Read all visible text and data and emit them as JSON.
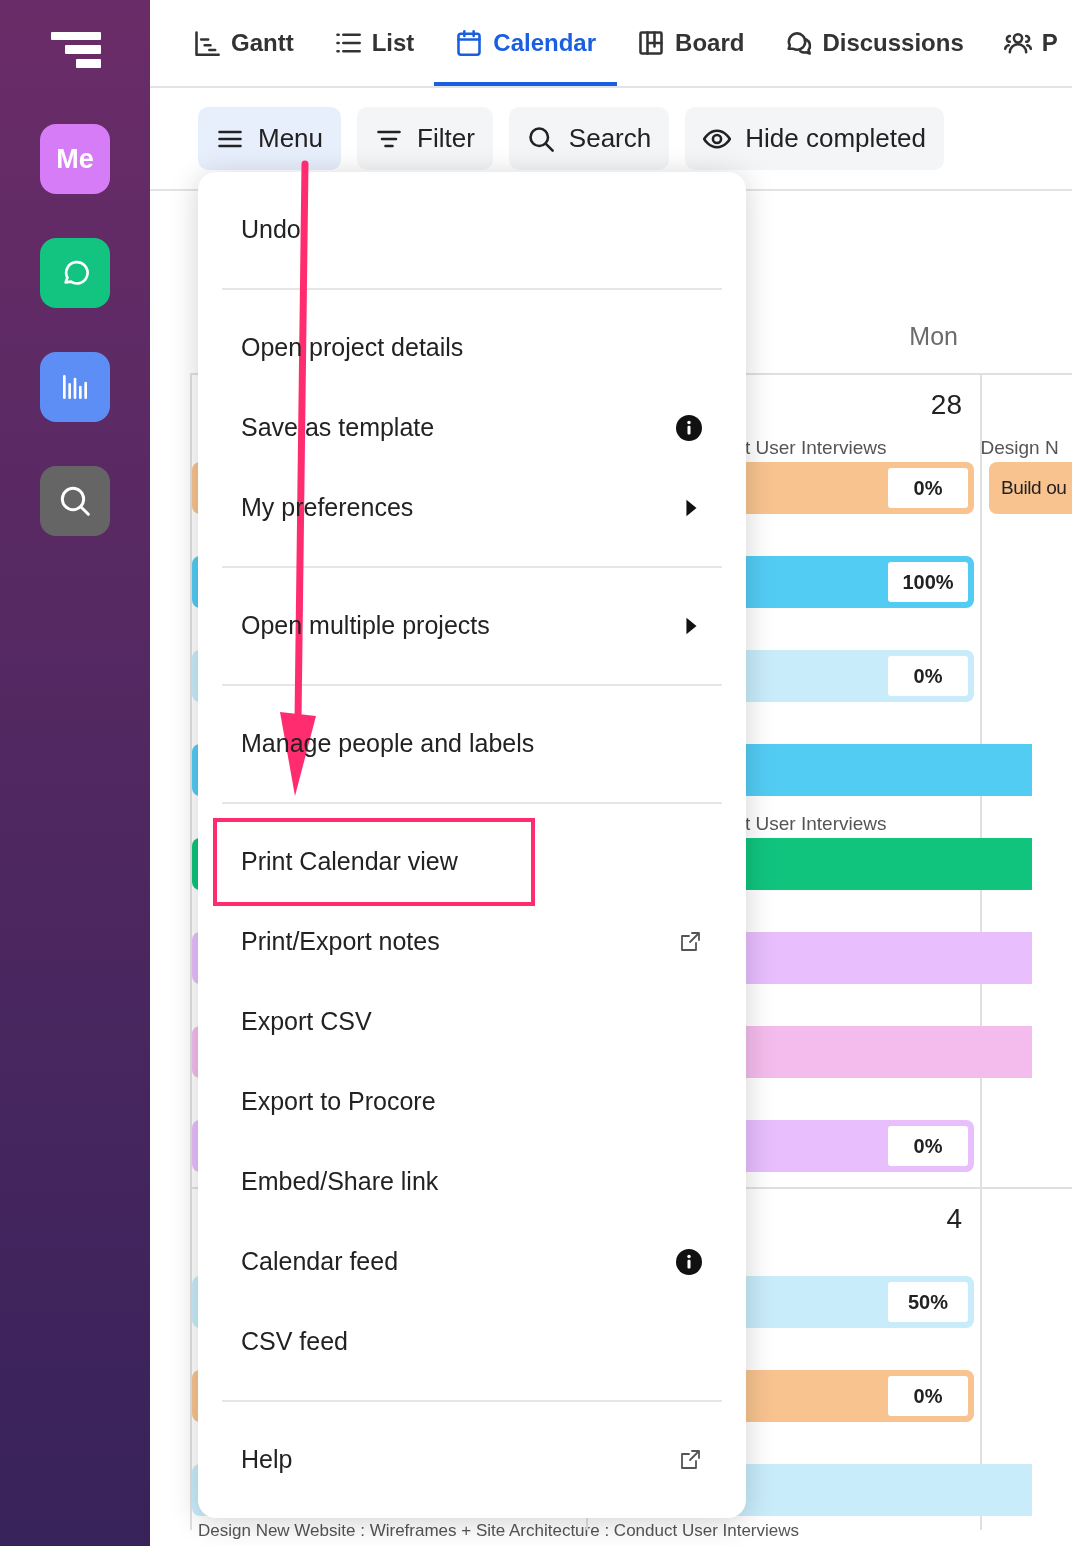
{
  "sidebar": {
    "items": [
      {
        "kind": "avatar",
        "label": "Me",
        "color": "#d57cf6"
      },
      {
        "kind": "chat",
        "color": "#12c480"
      },
      {
        "kind": "reports",
        "color": "#5d8ef6"
      },
      {
        "kind": "search",
        "color": "#656565"
      }
    ]
  },
  "tabs": [
    {
      "label": "Gantt",
      "kind": "gantt",
      "selected": false
    },
    {
      "label": "List",
      "kind": "list",
      "selected": false
    },
    {
      "label": "Calendar",
      "kind": "calendar",
      "selected": true
    },
    {
      "label": "Board",
      "kind": "board",
      "selected": false
    },
    {
      "label": "Discussions",
      "kind": "discussions",
      "selected": false
    },
    {
      "label": "P",
      "kind": "people",
      "selected": false
    }
  ],
  "toolbar": [
    {
      "label": "Menu",
      "kind": "menu",
      "selected": true
    },
    {
      "label": "Filter",
      "kind": "filter",
      "selected": false
    },
    {
      "label": "Search",
      "kind": "search",
      "selected": false
    },
    {
      "label": "Hide completed",
      "kind": "eye",
      "selected": false
    }
  ],
  "calendar": {
    "day_header": "Mon",
    "weeks": [
      {
        "day": "28",
        "events": [
          {
            "label": "t User Interviews",
            "color": "#f8c38f",
            "percent": "0%",
            "next_day_event": {
              "label": "Design N",
              "title": "Build ou",
              "color": "#f8c38f"
            }
          },
          {
            "color": "#53ccf4",
            "percent": "100%"
          },
          {
            "color": "#c8ecfa",
            "percent": "0%"
          },
          {
            "color": "#53ccf4"
          },
          {
            "label": "t User Interviews",
            "color": "#10c47e"
          },
          {
            "color": "#e8befd"
          },
          {
            "color": "#f4bcec"
          },
          {
            "color": "#e8befd",
            "percent": "0%"
          }
        ]
      },
      {
        "day": "4",
        "events": [
          {
            "color": "#c8ecfa",
            "percent": "50%"
          },
          {
            "color": "#f8c38f",
            "percent": "0%"
          },
          {
            "color": "#c8ecfa"
          }
        ]
      }
    ],
    "footer_text": "Design New Website : Wireframes + Site Architecture : Conduct User Interviews"
  },
  "menu": {
    "groups": [
      [
        {
          "label": "Undo"
        }
      ],
      [
        {
          "label": "Open project details"
        },
        {
          "label": "Save as template",
          "kind": "info"
        },
        {
          "label": "My preferences",
          "kind": "submenu"
        }
      ],
      [
        {
          "label": "Open multiple projects",
          "kind": "submenu"
        }
      ],
      [
        {
          "label": "Manage people and labels"
        }
      ],
      [
        {
          "label": "Print Calendar view",
          "highlighted": true
        },
        {
          "label": "Print/Export notes",
          "kind": "external"
        },
        {
          "label": "Export CSV"
        },
        {
          "label": "Export to Procore"
        },
        {
          "label": "Embed/Share link"
        },
        {
          "label": "Calendar feed",
          "kind": "info"
        },
        {
          "label": "CSV feed"
        }
      ],
      [
        {
          "label": "Help",
          "kind": "external"
        }
      ]
    ]
  }
}
